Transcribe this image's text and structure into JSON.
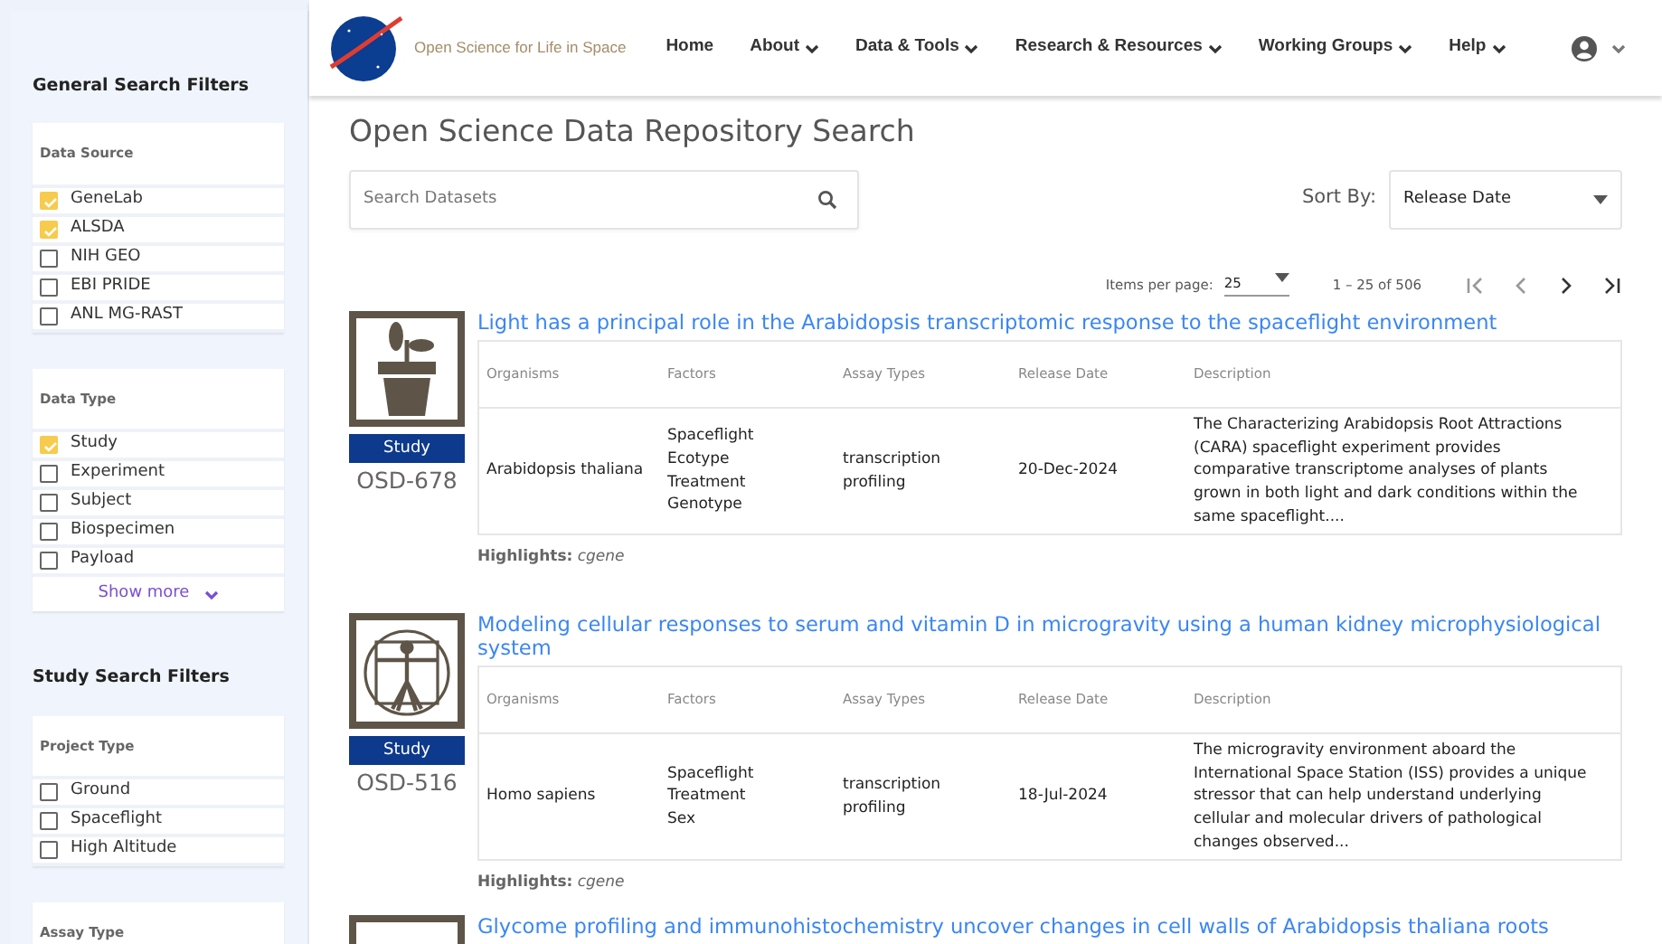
{
  "header": {
    "brand": "Open Science for Life in Space",
    "nav": [
      {
        "label": "Home",
        "dropdown": false
      },
      {
        "label": "About",
        "dropdown": true
      },
      {
        "label": "Data & Tools",
        "dropdown": true
      },
      {
        "label": "Research & Resources",
        "dropdown": true
      },
      {
        "label": "Working Groups",
        "dropdown": true
      },
      {
        "label": "Help",
        "dropdown": true
      }
    ]
  },
  "sidebar": {
    "sections": [
      {
        "title": "General Search Filters",
        "groups": [
          {
            "title": "Data Source",
            "options": [
              {
                "label": "GeneLab",
                "checked": true
              },
              {
                "label": "ALSDA",
                "checked": true
              },
              {
                "label": "NIH GEO",
                "checked": false
              },
              {
                "label": "EBI PRIDE",
                "checked": false
              },
              {
                "label": "ANL MG-RAST",
                "checked": false
              }
            ]
          },
          {
            "title": "Data Type",
            "options": [
              {
                "label": "Study",
                "checked": true
              },
              {
                "label": "Experiment",
                "checked": false
              },
              {
                "label": "Subject",
                "checked": false
              },
              {
                "label": "Biospecimen",
                "checked": false
              },
              {
                "label": "Payload",
                "checked": false
              }
            ],
            "show_more": "Show more"
          }
        ]
      },
      {
        "title": "Study Search Filters",
        "groups": [
          {
            "title": "Project Type",
            "options": [
              {
                "label": "Ground",
                "checked": false
              },
              {
                "label": "Spaceflight",
                "checked": false
              },
              {
                "label": "High Altitude",
                "checked": false
              }
            ]
          },
          {
            "title": "Assay Type"
          }
        ]
      }
    ]
  },
  "page_title": "Open Science Data Repository Search",
  "search": {
    "placeholder": "Search Datasets"
  },
  "sort": {
    "label": "Sort By:",
    "value": "Release Date"
  },
  "paginator": {
    "items_label": "Items per page:",
    "items_value": "25",
    "range": "1 – 25 of 506"
  },
  "results": [
    {
      "kind": "plant",
      "type": "Study",
      "id": "OSD-678",
      "title": "Light has a principal role in the Arabidopsis transcriptomic response to the spaceflight environment",
      "columns": [
        "Organisms",
        "Factors",
        "Assay Types",
        "Release Date",
        "Description"
      ],
      "organisms": "Arabidopsis thaliana",
      "factors": [
        "Spaceflight",
        "Ecotype",
        "Treatment",
        "Genotype"
      ],
      "assay_types": "transcription profiling",
      "release_date": "20-Dec-2024",
      "description": "The Characterizing Arabidopsis Root Attractions (CARA) spaceflight experiment provides comparative transcriptome analyses of plants grown in both light and dark conditions within the same spaceflight....",
      "highlights_label": "Highlights:",
      "highlights": "cgene"
    },
    {
      "kind": "human",
      "type": "Study",
      "id": "OSD-516",
      "title": "Modeling cellular responses to serum and vitamin D in microgravity using a human kidney microphysiological system",
      "columns": [
        "Organisms",
        "Factors",
        "Assay Types",
        "Release Date",
        "Description"
      ],
      "organisms": "Homo sapiens",
      "factors": [
        "Spaceflight",
        "Treatment",
        "Sex"
      ],
      "assay_types": "transcription profiling",
      "release_date": "18-Jul-2024",
      "description": "The microgravity environment aboard the International Space Station (ISS) provides a unique stressor that can help understand underlying cellular and molecular drivers of pathological changes observed...",
      "highlights_label": "Highlights:",
      "highlights": "cgene"
    },
    {
      "title": "Glycome profiling and immunohistochemistry uncover changes in cell walls of Arabidopsis thaliana roots"
    }
  ]
}
